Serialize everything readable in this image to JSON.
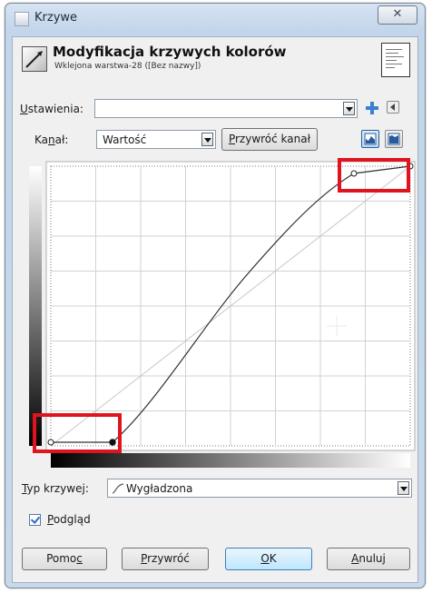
{
  "window": {
    "title": "Krzywe",
    "close_symbol": "✕"
  },
  "header": {
    "title": "Modyfikacja krzywych kolorów",
    "subtitle": "Wklejona warstwa-28 ([Bez nazwy])"
  },
  "presets": {
    "label": "Ustawienia:",
    "value": ""
  },
  "channel": {
    "label": "Kanał:",
    "value": "Wartość",
    "reset_button": "Przywróć kanał"
  },
  "curve_type": {
    "label": "Typ krzywej:",
    "value": "Wygładzona"
  },
  "preview": {
    "label": "Podgląd",
    "checked": true
  },
  "buttons": {
    "help": "Pomoc",
    "reset": "Przywróć",
    "ok": "OK",
    "cancel": "Anuluj"
  },
  "colors": {
    "highlight": "#e0141e",
    "curve": "#303030",
    "grid": "#d2d2d2"
  }
}
